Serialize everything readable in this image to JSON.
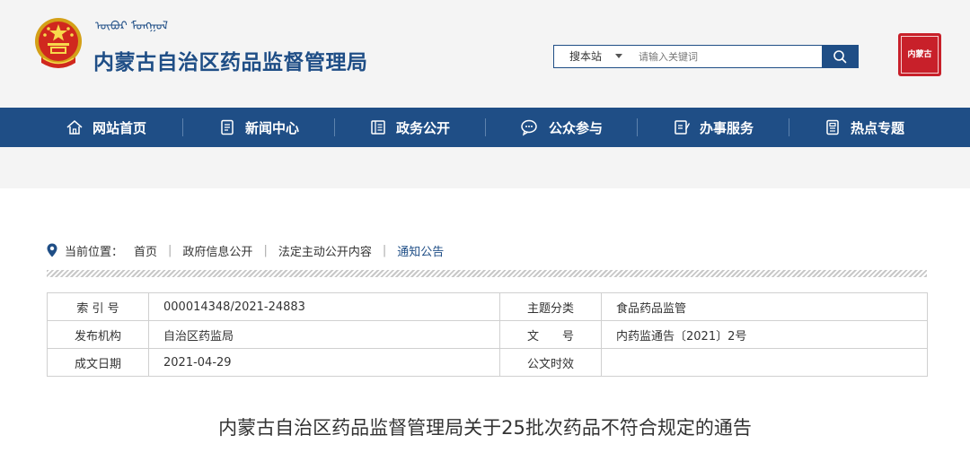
{
  "header": {
    "mongol_script": "ᠦᠪᠦᠷ ᠮᠣᠩᠭᠣᠯ",
    "site_title": "内蒙古自治区药品监督管理局",
    "seal_text": "内蒙古",
    "search": {
      "scope": "搜本站",
      "placeholder": "请输入关键词"
    }
  },
  "nav": {
    "items": [
      {
        "label": "网站首页",
        "icon": "home-icon"
      },
      {
        "label": "新闻中心",
        "icon": "news-icon"
      },
      {
        "label": "政务公开",
        "icon": "gov-open-icon"
      },
      {
        "label": "公众参与",
        "icon": "chat-icon"
      },
      {
        "label": "办事服务",
        "icon": "service-icon"
      },
      {
        "label": "热点专题",
        "icon": "topic-icon"
      }
    ]
  },
  "breadcrumb": {
    "label": "当前位置：",
    "items": [
      "首页",
      "政府信息公开",
      "法定主动公开内容",
      "通知公告"
    ]
  },
  "meta": {
    "rows": [
      {
        "l1": "索 引 号",
        "v1": "000014348/2021-24883",
        "l2": "主题分类",
        "v2": "食品药品监管"
      },
      {
        "l1": "发布机构",
        "v1": "自治区药监局",
        "l2": "文　　号",
        "v2": "内药监通告〔2021〕2号"
      },
      {
        "l1": "成文日期",
        "v1": "2021-04-29",
        "l2": "公文时效",
        "v2": ""
      }
    ]
  },
  "article": {
    "title": "内蒙古自治区药品监督管理局关于25批次药品不符合规定的通告"
  },
  "colors": {
    "brand_blue": "#1f4e86",
    "seal_red": "#c8202a"
  }
}
